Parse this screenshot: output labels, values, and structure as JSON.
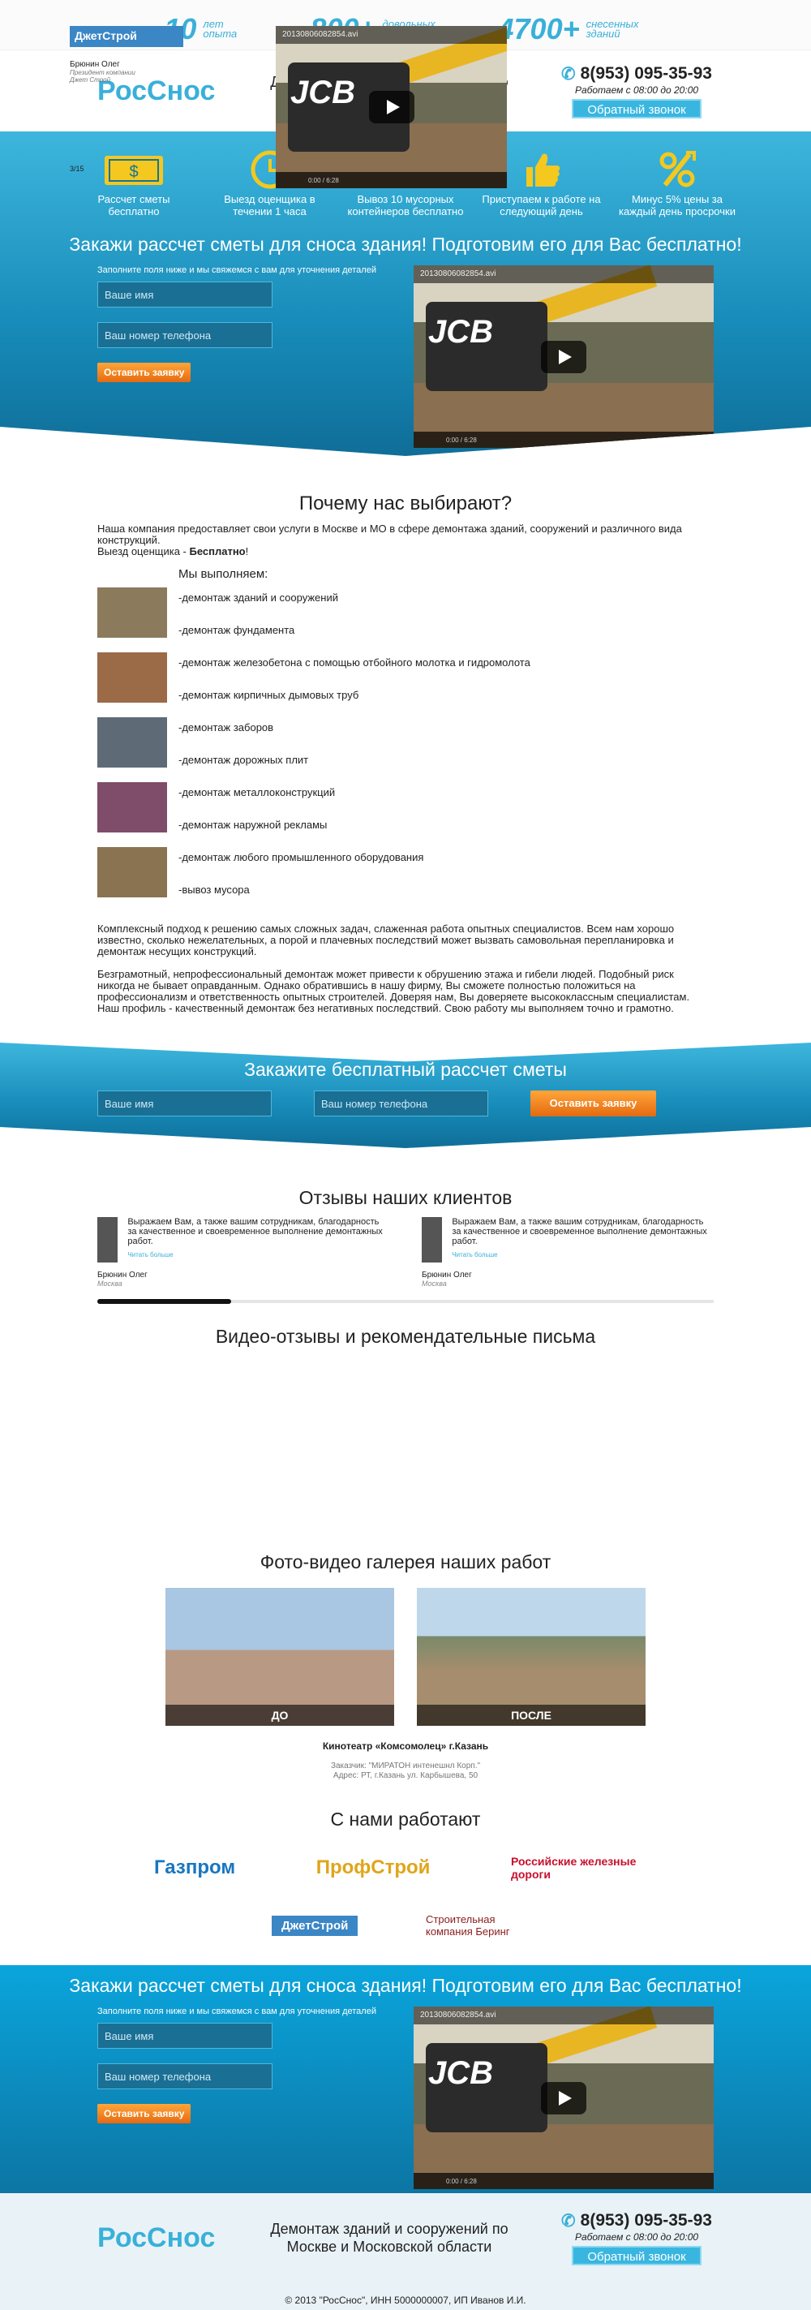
{
  "stats": [
    {
      "num": "10",
      "label": "лет опыта"
    },
    {
      "num": "800+",
      "label": "довольных клиентов"
    },
    {
      "num": "4700+",
      "label": "снесенных зданий"
    }
  ],
  "header": {
    "logo": "РосСнос",
    "tagline": "Демонтаж зданий и сооружений по Москве и Московской области",
    "phone": "8(953) 095-35-93",
    "hours": "Работаем с 08:00 до 20:00",
    "callback": "Обратный звонок"
  },
  "features": [
    {
      "icon": "money-icon",
      "text": "Рассчет сметы бесплатно"
    },
    {
      "icon": "clock-icon",
      "text": "Выезд оценщика в течении 1 часа"
    },
    {
      "icon": "truck-icon",
      "text": "Вывоз 10 мусорных контейнеров бесплатно"
    },
    {
      "icon": "thumbs-up-icon",
      "text": "Приступаем к работе на следующий день"
    },
    {
      "icon": "percent-icon",
      "text": "Минус 5% цены за каждый день просрочки"
    }
  ],
  "hero": {
    "title": "Закажи рассчет сметы для сноса здания! Подготовим его для Вас бесплатно!",
    "note": "Заполните поля ниже и мы свяжемся с вам для уточнения деталей",
    "name_placeholder": "Ваше имя",
    "phone_placeholder": "Ваш номер телефона",
    "submit": "Оставить заявку",
    "video_title": "20130806082854.avi",
    "video_time": "0:00 / 6:28",
    "video_brand": "JCB"
  },
  "why": {
    "title": "Почему нас выбирают?",
    "intro": "Наша компания предоставляет свои услуги в Москве и МО в сфере демонтажа зданий, сооружений и различного вида конструкций.",
    "visit_prefix": "Выезд оценщика - ",
    "visit_bold": "Бесплатно",
    "visit_suffix": "!",
    "list_title": "Мы выполняем:",
    "services": [
      "-демонтаж зданий и сооружений",
      "-демонтаж фундамента",
      "-демонтаж железобетона с помощью отбойного молотка и гидромолота",
      "-демонтаж кирпичных дымовых труб",
      "-демонтаж заборов",
      "-демонтаж дорожных плит",
      "-демонтаж металлоконструкций",
      "-демонтаж наружной рекламы",
      "-демонтаж любого промышленного оборудования",
      "-вывоз мусора"
    ],
    "para1": "Комплексный подход к решению самых сложных задач, слаженная работа опытных специалистов. Всем нам хорошо известно, сколько нежелательных, а порой и плачевных последствий может вызвать самовольная перепланировка и демонтаж несущих конструкций.",
    "para2": "Безграмотный, непрофессиональный демонтаж может привести к обрушению этажа и гибели людей. Подобный риск никогда не бывает оправданным. Однако обратившись в нашу фирму, Вы сможете полностью положиться на профессионализм и ответственность опытных строителей. Доверяя нам, Вы доверяете высококлассным специалистам. Наш профиль - качественный демонтаж без негативных последствий. Свою работу мы выполняем точно и грамотно."
  },
  "order": {
    "title": "Закажите бесплатный рассчет сметы",
    "name_placeholder": "Ваше имя",
    "phone_placeholder": "Ваш номер телефона",
    "submit": "Оставить заявку"
  },
  "reviews": {
    "title": "Отзывы наших клиентов",
    "items": [
      {
        "text": "Выражаем Вам, а также вашим сотрудникам, благодарность за качественное и своевременное выполнение демонтажных работ.",
        "more": "Читать больше",
        "name": "Брюнин Олег",
        "city": "Москва"
      },
      {
        "text": "Выражаем Вам, а также вашим сотрудникам, благодарность за качественное и своевременное выполнение демонтажных работ.",
        "more": "Читать больше",
        "name": "Брюнин Олег",
        "city": "Москва"
      }
    ]
  },
  "video_reviews": {
    "title": "Видео-отзывы и рекомендательные письма",
    "logo": "ДжетСтрой",
    "person": "Брюнин Олег",
    "role": "Президент компании",
    "company": "Джет Строй",
    "counter": "3/15",
    "video_title": "20130806082854.avi",
    "video_time": "0:00 / 6:28"
  },
  "gallery": {
    "title": "Фото-видео галерея наших работ",
    "before": "ДО",
    "after": "ПОСЛЕ",
    "object": "Кинотеатр «Комсомолец» г.Казань",
    "client": "Заказчик: \"МИРАТОН интенешнл Корп.\"",
    "address": "Адрес: РТ, г.Казань ул. Карбышева, 50"
  },
  "partners": {
    "title": "С нами работают",
    "items": [
      "Газпром",
      "ПрофСтрой",
      "Российские железные дороги",
      "ДжетСтрой",
      "Строительная компания Беринг"
    ]
  },
  "footer": {
    "copyright": "© 2013 \"РосСнос\", ИНН 5000000007, ИП Иванов И.И."
  },
  "colors": {
    "accent": "#39b0d9",
    "orange": "#f08a1c"
  }
}
